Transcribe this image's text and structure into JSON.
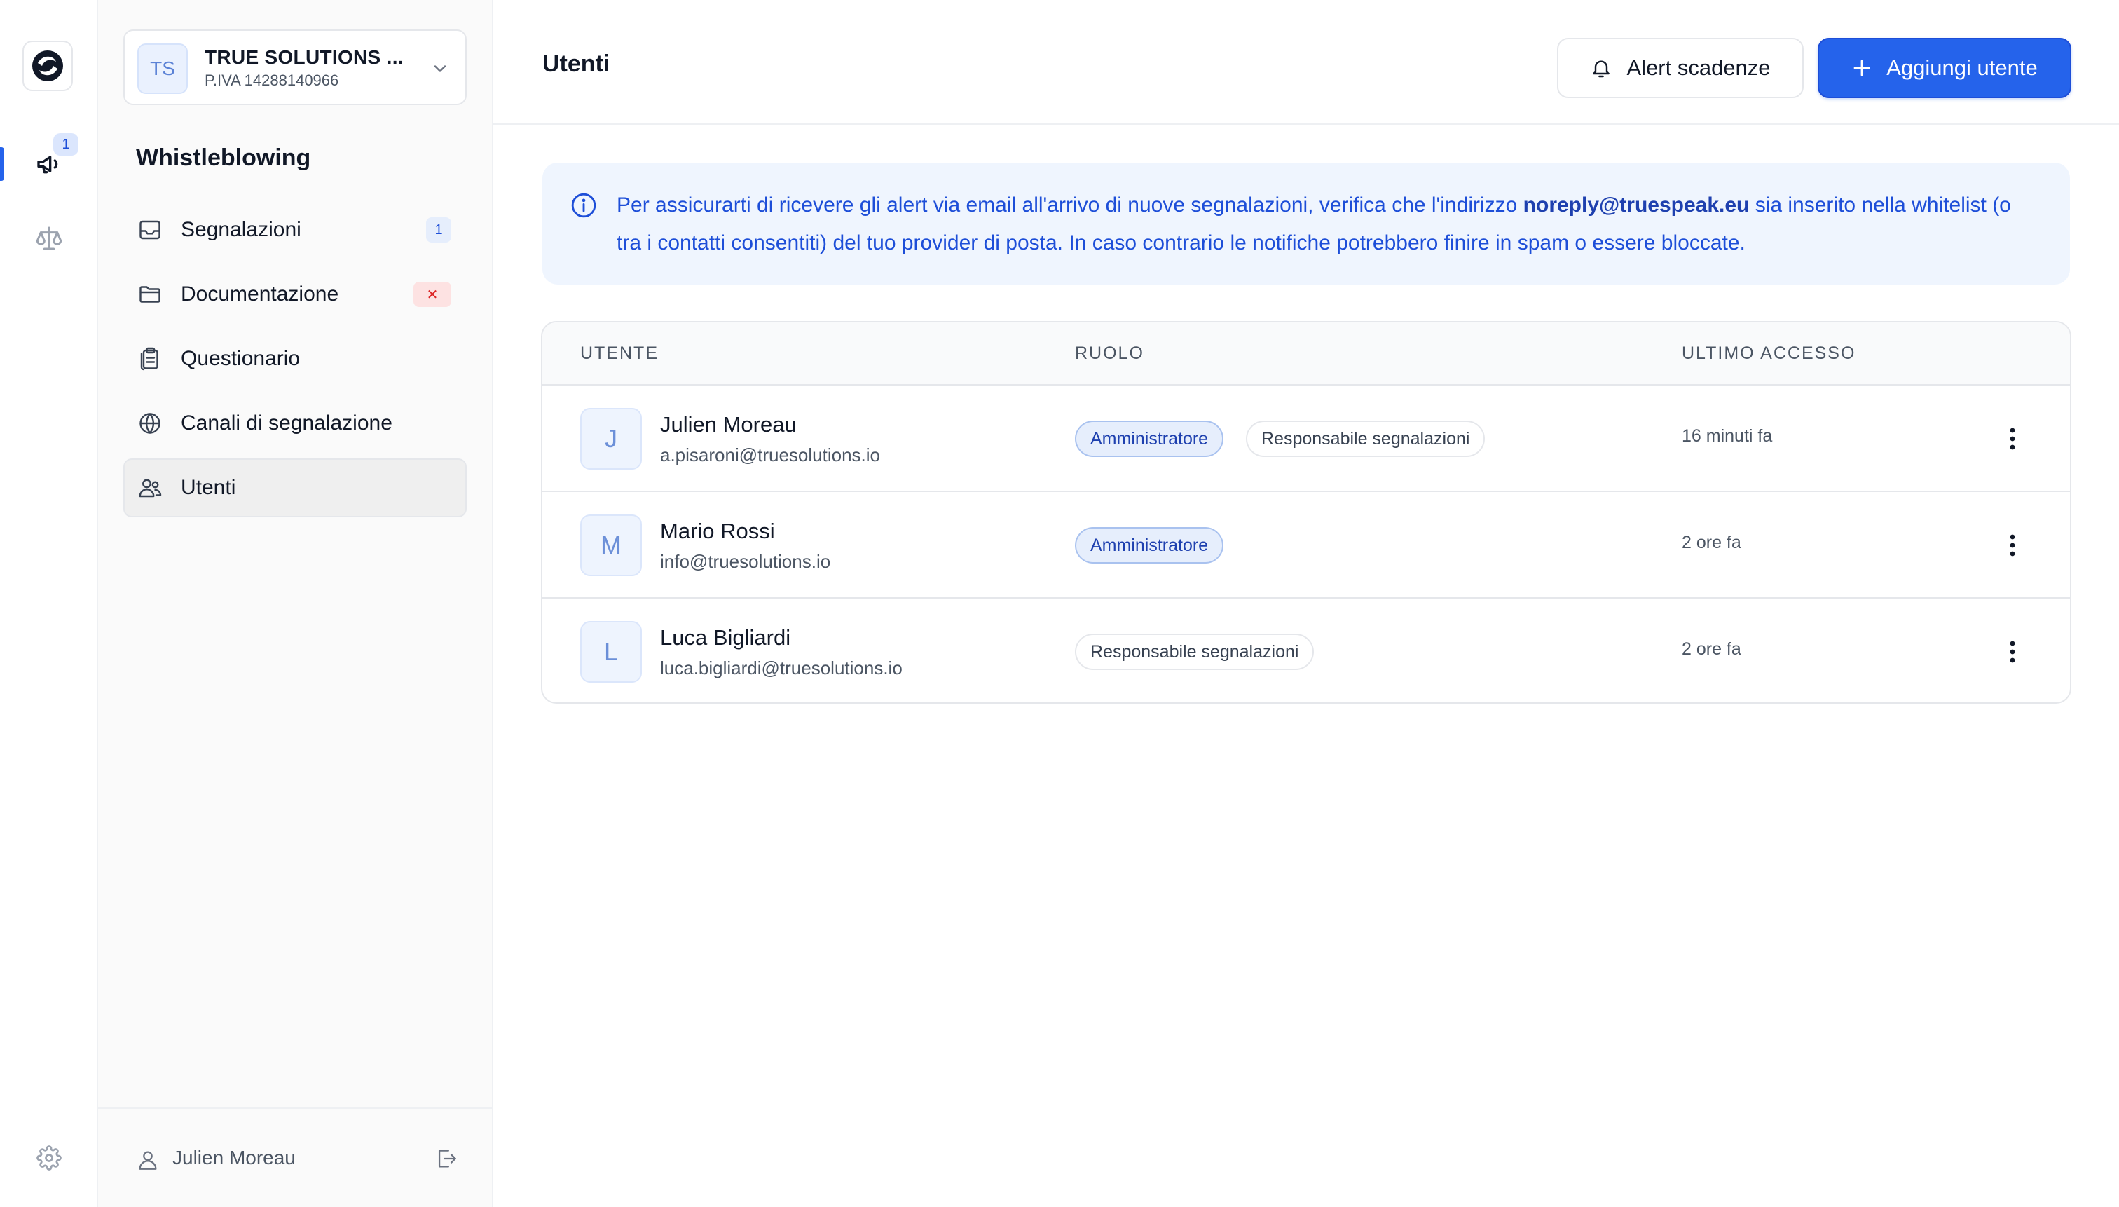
{
  "rail": {
    "notification_count": "1",
    "items": [
      {
        "icon": "megaphone-icon",
        "active": true
      },
      {
        "icon": "scale-icon",
        "active": false
      }
    ],
    "settings_icon": "gear-icon"
  },
  "organization": {
    "initials": "TS",
    "name": "TRUE SOLUTIONS ...",
    "vat": "P.IVA 14288140966"
  },
  "sidebar": {
    "section_title": "Whistleblowing",
    "items": [
      {
        "label": "Segnalazioni",
        "icon": "inbox-icon",
        "badge": "1"
      },
      {
        "label": "Documentazione",
        "icon": "folder-icon",
        "badge": "✕"
      },
      {
        "label": "Questionario",
        "icon": "clipboard-icon",
        "badge": ""
      },
      {
        "label": "Canali di segnalazione",
        "icon": "globe-icon",
        "badge": ""
      },
      {
        "label": "Utenti",
        "icon": "users-icon",
        "badge": "",
        "active": true
      }
    ],
    "footer_user": "Julien Moreau"
  },
  "header": {
    "title": "Utenti",
    "alert_button": "Alert scadenze",
    "add_button": "Aggiungi utente"
  },
  "banner": {
    "text_before": "Per assicurarti di ricevere gli alert via email all'arrivo di nuove segnalazioni, verifica che l'indirizzo ",
    "email": "noreply@truespeak.eu",
    "text_after": " sia inserito nella whitelist (o tra i contatti consentiti) del tuo provider di posta. In caso contrario le notifiche potrebbero finire in spam o essere bloccate."
  },
  "table": {
    "columns": [
      "UTENTE",
      "RUOLO",
      "ULTIMO ACCESSO"
    ],
    "rows": [
      {
        "initial": "J",
        "name": "Julien Moreau",
        "email": "a.pisaroni@truesolutions.io",
        "roles": [
          "Amministratore",
          "Responsabile segnalazioni"
        ],
        "last_access": "16 minuti fa"
      },
      {
        "initial": "M",
        "name": "Mario Rossi",
        "email": "info@truesolutions.io",
        "roles": [
          "Amministratore"
        ],
        "last_access": "2 ore fa"
      },
      {
        "initial": "L",
        "name": "Luca Bigliardi",
        "email": "luca.bigliardi@truesolutions.io",
        "roles": [
          "Responsabile segnalazioni"
        ],
        "last_access": "2 ore fa"
      }
    ]
  },
  "colors": {
    "accent": "#2563eb",
    "banner_bg": "#eff5fe",
    "banner_text": "#1d4ed8",
    "error": "#dc2626"
  }
}
